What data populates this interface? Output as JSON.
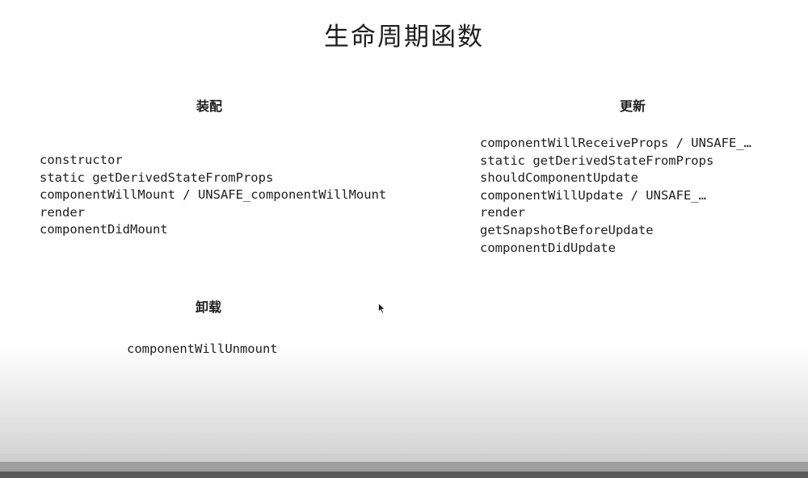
{
  "title": "生命周期函数",
  "sections": {
    "mount": {
      "heading": "装配",
      "methods": [
        "constructor",
        "static getDerivedStateFromProps",
        "componentWillMount / UNSAFE_componentWillMount",
        "render",
        "componentDidMount"
      ]
    },
    "update": {
      "heading": "更新",
      "methods": [
        "componentWillReceiveProps / UNSAFE_…",
        "static getDerivedStateFromProps",
        "shouldComponentUpdate",
        "componentWillUpdate / UNSAFE_…",
        "render",
        "getSnapshotBeforeUpdate",
        "componentDidUpdate"
      ]
    },
    "unmount": {
      "heading": "卸载",
      "methods": [
        "componentWillUnmount"
      ]
    }
  },
  "icons": {
    "cursor": "mouse-pointer-icon"
  }
}
